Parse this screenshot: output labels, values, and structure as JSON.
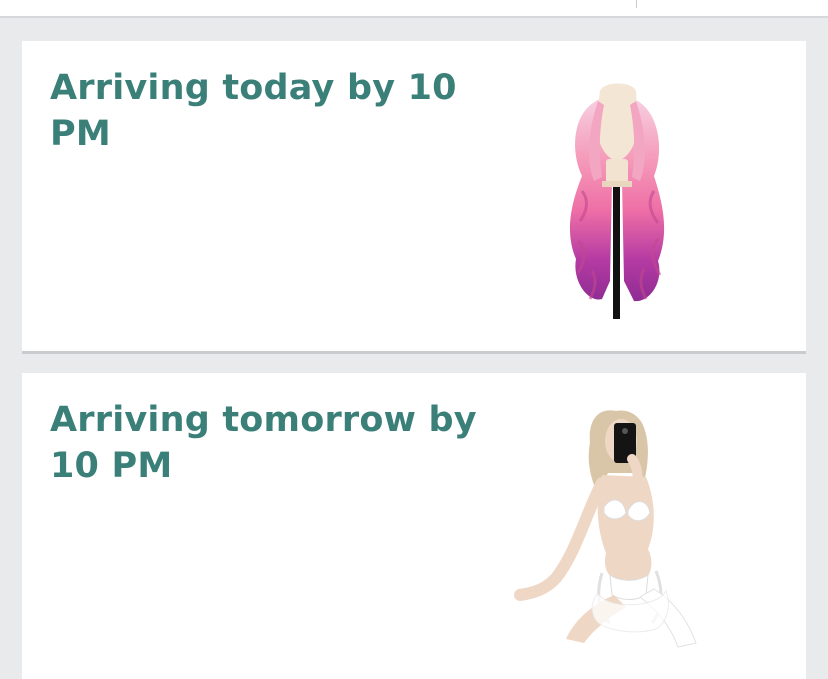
{
  "orders": [
    {
      "arrival_text": "Arriving today by 10 PM",
      "product_image": "pink-purple-ombre-wig-on-mannequin-stand"
    },
    {
      "arrival_text": "Arriving tomorrow by 10 PM",
      "product_image": "white-lace-lingerie-set-on-model"
    }
  ],
  "colors": {
    "arrival_text": "#3b7f79",
    "background": "#e9eaec",
    "card": "#ffffff"
  }
}
